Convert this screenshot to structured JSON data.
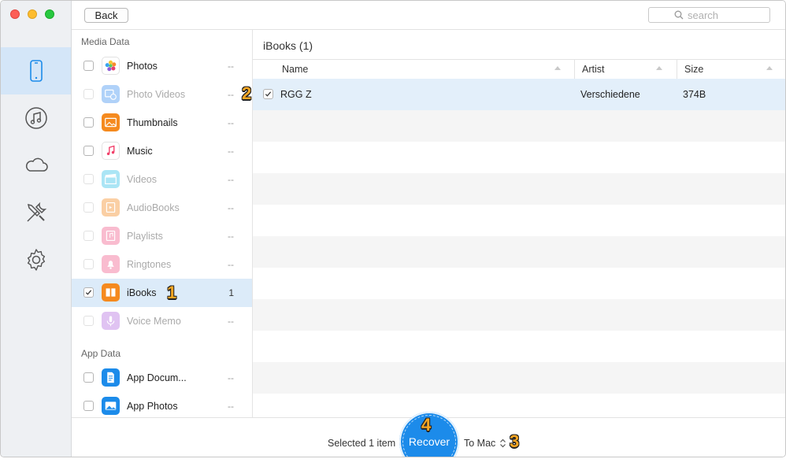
{
  "toolbar": {
    "back_label": "Back",
    "search_placeholder": "search"
  },
  "rail": {
    "items": [
      {
        "name": "device",
        "icon": "phone-icon",
        "active": true
      },
      {
        "name": "itunes",
        "icon": "music-note-icon",
        "active": false
      },
      {
        "name": "icloud",
        "icon": "cloud-icon",
        "active": false
      },
      {
        "name": "tools",
        "icon": "tools-icon",
        "active": false
      },
      {
        "name": "settings",
        "icon": "gear-icon",
        "active": false
      }
    ]
  },
  "sidebar": {
    "media_header": "Media Data",
    "app_header": "App Data",
    "media_items": [
      {
        "label": "Photos",
        "count": "--",
        "icon": "photos-icon",
        "enabled": true,
        "checked": false,
        "selected": false,
        "color": "#ffffff"
      },
      {
        "label": "Photo Videos",
        "count": "--",
        "icon": "photo-videos-icon",
        "enabled": false,
        "checked": false,
        "selected": false,
        "color": "#3b8ff0"
      },
      {
        "label": "Thumbnails",
        "count": "--",
        "icon": "thumbnails-icon",
        "enabled": true,
        "checked": false,
        "selected": false,
        "color": "#f58a1f"
      },
      {
        "label": "Music",
        "count": "--",
        "icon": "music-icon",
        "enabled": true,
        "checked": false,
        "selected": false,
        "color": "#ffffff"
      },
      {
        "label": "Videos",
        "count": "--",
        "icon": "videos-icon",
        "enabled": false,
        "checked": false,
        "selected": false,
        "color": "#2fc0e8"
      },
      {
        "label": "AudioBooks",
        "count": "--",
        "icon": "audiobooks-icon",
        "enabled": false,
        "checked": false,
        "selected": false,
        "color": "#f58a1f"
      },
      {
        "label": "Playlists",
        "count": "--",
        "icon": "playlists-icon",
        "enabled": false,
        "checked": false,
        "selected": false,
        "color": "#f25a8a"
      },
      {
        "label": "Ringtones",
        "count": "--",
        "icon": "ringtones-icon",
        "enabled": false,
        "checked": false,
        "selected": false,
        "color": "#f25a8a"
      },
      {
        "label": "iBooks",
        "count": "1",
        "icon": "ibooks-icon",
        "enabled": true,
        "checked": true,
        "selected": true,
        "color": "#f58a1f"
      },
      {
        "label": "Voice Memo",
        "count": "--",
        "icon": "voice-memo-icon",
        "enabled": false,
        "checked": false,
        "selected": false,
        "color": "#b26be0"
      }
    ],
    "app_items": [
      {
        "label": "App Docum...",
        "count": "--",
        "icon": "app-documents-icon",
        "enabled": true,
        "checked": false,
        "selected": false,
        "color": "#1c8bea"
      },
      {
        "label": "App Photos",
        "count": "--",
        "icon": "app-photos-icon",
        "enabled": true,
        "checked": false,
        "selected": false,
        "color": "#1c8bea"
      }
    ]
  },
  "main": {
    "title": "iBooks (1)",
    "columns": {
      "name": "Name",
      "artist": "Artist",
      "size": "Size"
    },
    "rows": [
      {
        "name": "RGG Z",
        "artist": "Verschiedene",
        "size": "374B",
        "checked": true
      }
    ]
  },
  "footer": {
    "selected_text": "Selected 1 item",
    "recover_label": "Recover",
    "destination": "To Mac"
  },
  "steps": [
    "1",
    "2",
    "3",
    "4"
  ],
  "colors": {
    "accent": "#1c8bea",
    "selection": "#dcebf9",
    "step_badge": "#f6a623"
  }
}
